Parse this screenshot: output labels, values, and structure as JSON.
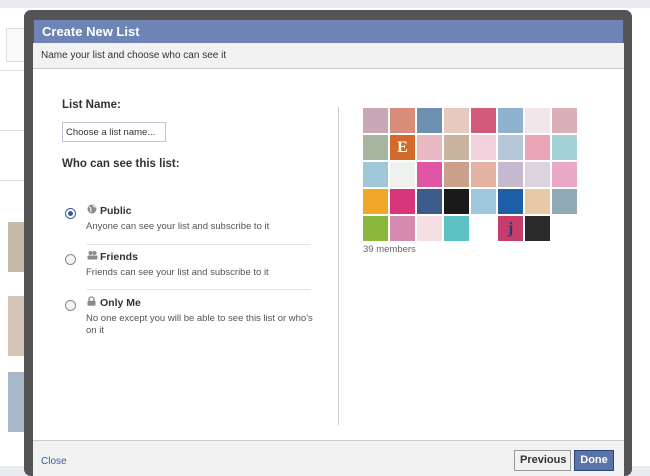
{
  "dialog": {
    "title": "Create New List",
    "subtitle": "Name your list and choose who can see it"
  },
  "list_name": {
    "label": "List Name:",
    "placeholder": "Choose a list name..."
  },
  "visibility": {
    "label": "Who can see this list:",
    "options": [
      {
        "icon": "globe-icon",
        "title": "Public",
        "description": "Anyone can see your list and subscribe to it",
        "selected": true
      },
      {
        "icon": "friends-icon",
        "title": "Friends",
        "description": "Friends can see your list and subscribe to it",
        "selected": false
      },
      {
        "icon": "lock-icon",
        "title": "Only Me",
        "description": "No one except you will be able to see this list or who's on it",
        "selected": false
      }
    ]
  },
  "members": {
    "count_text": "39 members",
    "thumb_colors": [
      "#c9a7b5",
      "#d88c7a",
      "#6f8fb0",
      "#e7c9c0",
      "#d35a7a",
      "#8fb3cf",
      "#f2e6ea",
      "#d9aeb4",
      "#a8b6a1",
      "#d26a2c",
      "#e8b9c0",
      "#c9b39f",
      "#f1d2dc",
      "#b7c8d8",
      "#eaa6b6",
      "#a3d3d6",
      "#9fc7d8",
      "#eef1ee",
      "#e055a6",
      "#caa08b",
      "#e3b2a2",
      "#c4b9cf",
      "#ddd3dd",
      "#e9a9c6",
      "#f1a82a",
      "#d9357b",
      "#3c5a8a",
      "#1a1a1a",
      "#9ec7dc",
      "#1f5fa8",
      "#e6c9a6",
      "#8fa9b5",
      "#8ab83d",
      "#d88bb0",
      "#f3dfe4",
      "#5ec2c2",
      "#ffffff",
      "#c63d6c",
      "#2a2a2a"
    ],
    "thumb_letters": [
      "E",
      "j"
    ]
  },
  "footer": {
    "close_label": "Close",
    "previous_label": "Previous",
    "done_label": "Done"
  }
}
